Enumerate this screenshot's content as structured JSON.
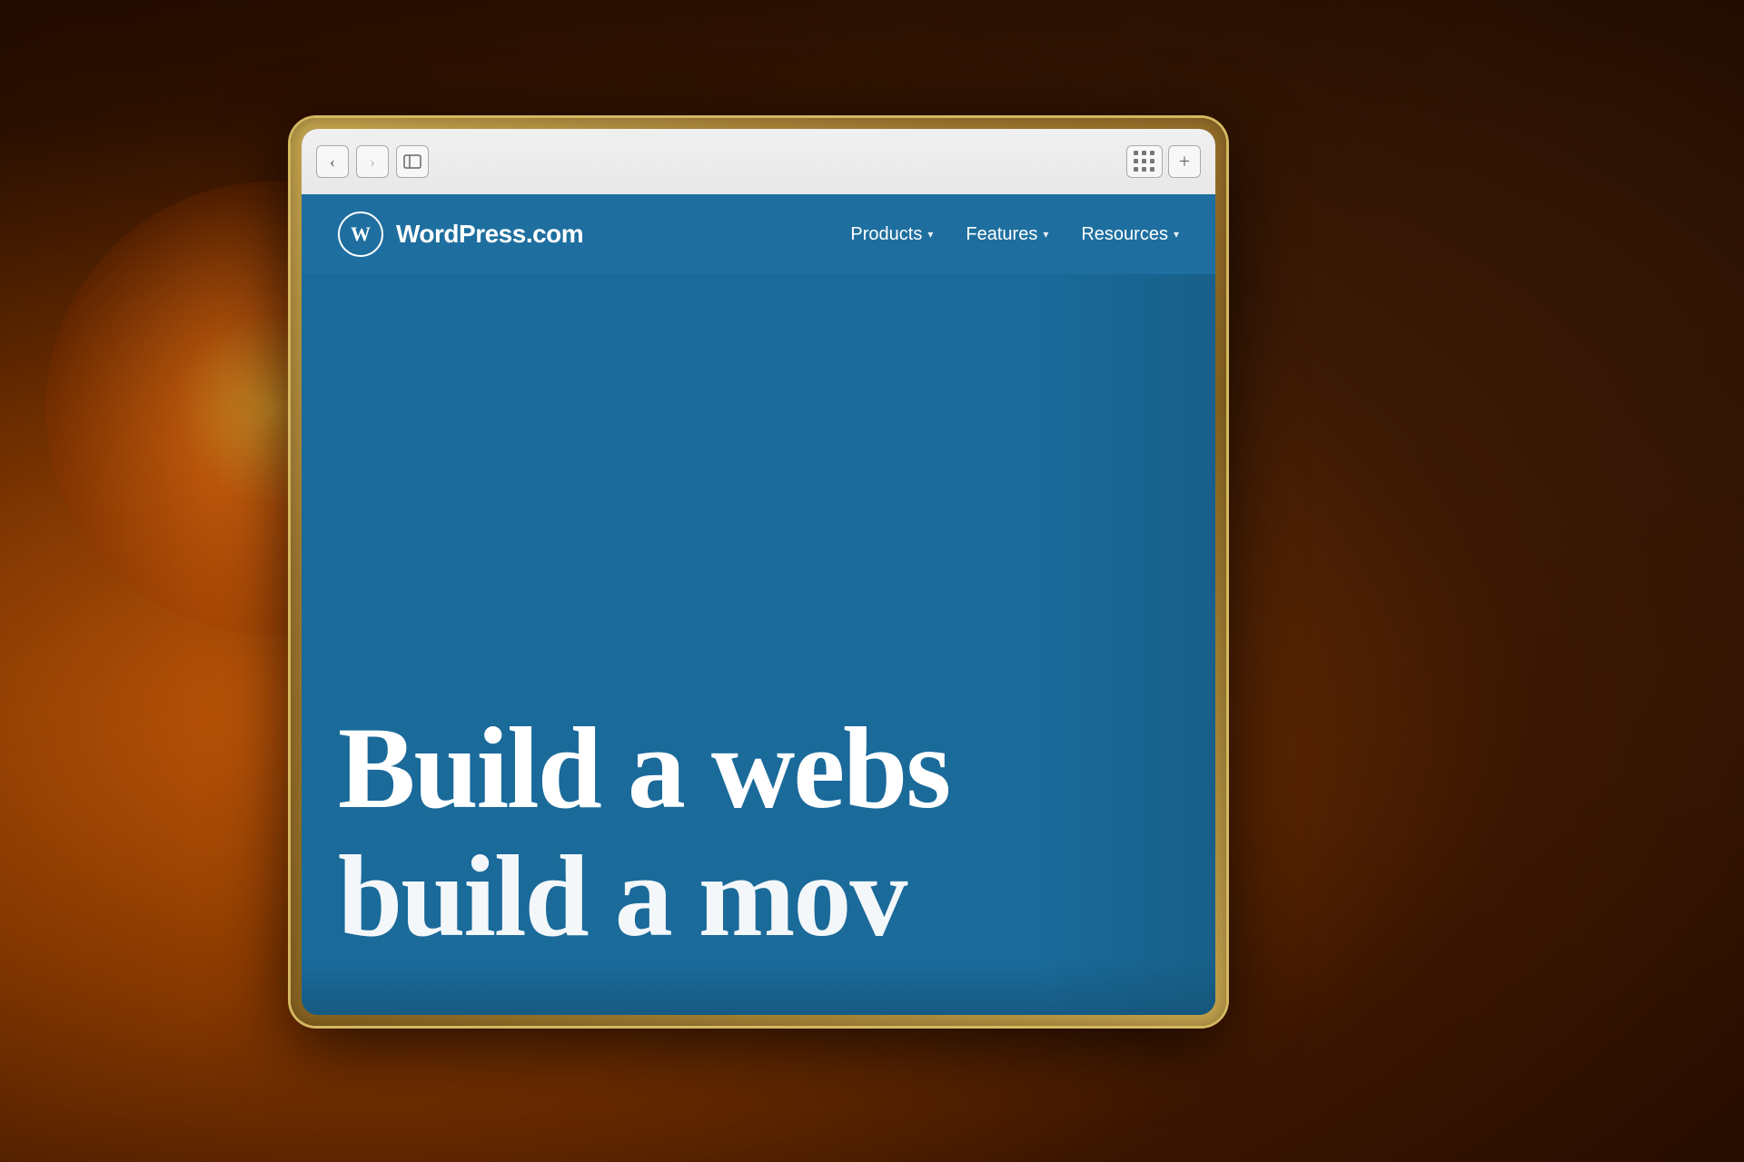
{
  "background": {
    "description": "Warm bokeh background with orange/amber light"
  },
  "browser": {
    "back_button_label": "‹",
    "forward_button_label": "›",
    "sidebar_toggle_label": "□",
    "plus_button_label": "+",
    "back_aria": "Back",
    "forward_aria": "Forward",
    "sidebar_aria": "Toggle sidebar",
    "grid_aria": "Extensions",
    "plus_aria": "New tab"
  },
  "website": {
    "logo_letter": "W",
    "site_name": "WordPress.com",
    "nav_items": [
      {
        "label": "Products",
        "has_dropdown": true
      },
      {
        "label": "Features",
        "has_dropdown": true
      },
      {
        "label": "Resources",
        "has_dropdown": true
      }
    ],
    "hero": {
      "line1": "Build a webs",
      "line2": "build a mov"
    },
    "brand_color": "#1e6f9f"
  }
}
